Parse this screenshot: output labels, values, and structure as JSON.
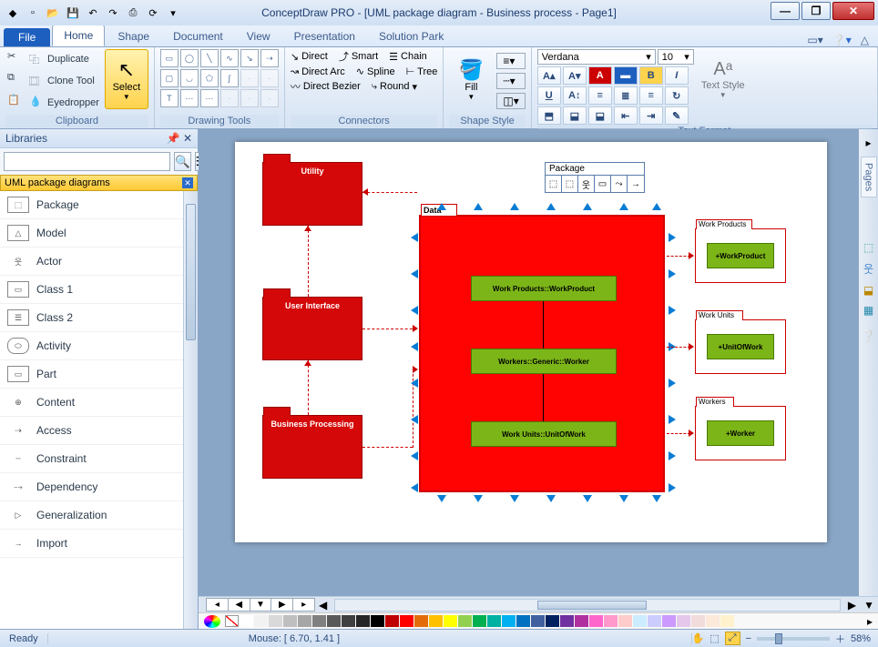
{
  "window": {
    "title": "ConceptDraw PRO - [UML package diagram - Business process - Page1]"
  },
  "tabs": {
    "file": "File",
    "items": [
      "Home",
      "Shape",
      "Document",
      "View",
      "Presentation",
      "Solution Park"
    ],
    "active": 0
  },
  "ribbon": {
    "clipboard": {
      "title": "Clipboard",
      "duplicate": "Duplicate",
      "clone": "Clone Tool",
      "eyedropper": "Eyedropper",
      "select": "Select"
    },
    "drawing": {
      "title": "Drawing Tools"
    },
    "connectors": {
      "title": "Connectors",
      "direct": "Direct",
      "directarc": "Direct Arc",
      "directbezier": "Direct Bezier",
      "smart": "Smart",
      "spline": "Spline",
      "round": "Round",
      "chain": "Chain",
      "tree": "Tree"
    },
    "shapestyle": {
      "title": "Shape Style",
      "fill": "Fill"
    },
    "textformat": {
      "title": "Text Format",
      "font": "Verdana",
      "size": "10",
      "textstyle": "Text Style"
    }
  },
  "libraries": {
    "header": "Libraries",
    "search_placeholder": "",
    "current": "UML package diagrams",
    "items": [
      "Package",
      "Model",
      "Actor",
      "Class 1",
      "Class 2",
      "Activity",
      "Part",
      "Content",
      "Access",
      "Constraint",
      "Dependency",
      "Generalization",
      "Import"
    ]
  },
  "canvas": {
    "packages": {
      "utility": "Utility",
      "ui": "User Interface",
      "bp": "Business Processing",
      "data": "Data",
      "wp_group": "Work Products",
      "wp_inner": "+WorkProduct",
      "wu_group": "Work Units",
      "wu_inner": "+UnitOfWork",
      "wk_group": "Workers",
      "wk_inner": "+Worker"
    },
    "classes": {
      "c1": "Work Products::WorkProduct",
      "c2": "Workers::Generic::Worker",
      "c3": "Work Units::UnitOfWork"
    },
    "smart_tag": {
      "label": "Package"
    },
    "pages_tab": "Pages"
  },
  "palette_colors": [
    "#ffffff",
    "#f2f2f2",
    "#d9d9d9",
    "#bfbfbf",
    "#a6a6a6",
    "#808080",
    "#595959",
    "#404040",
    "#262626",
    "#000000",
    "#c00000",
    "#ff0000",
    "#e46c0a",
    "#ffc000",
    "#ffff00",
    "#92d050",
    "#00b050",
    "#00b0a0",
    "#00b0f0",
    "#0070c0",
    "#4060a0",
    "#002060",
    "#7030a0",
    "#b030a0",
    "#ff66cc",
    "#ff99cc",
    "#ffcccc",
    "#ccecff",
    "#ccccff",
    "#cc99ff",
    "#e4c7eb",
    "#f2dcdb",
    "#fde9d9",
    "#fff2cc"
  ],
  "status": {
    "ready": "Ready",
    "mouse": "Mouse: [ 6.70, 1.41 ]",
    "zoom": "58%"
  }
}
